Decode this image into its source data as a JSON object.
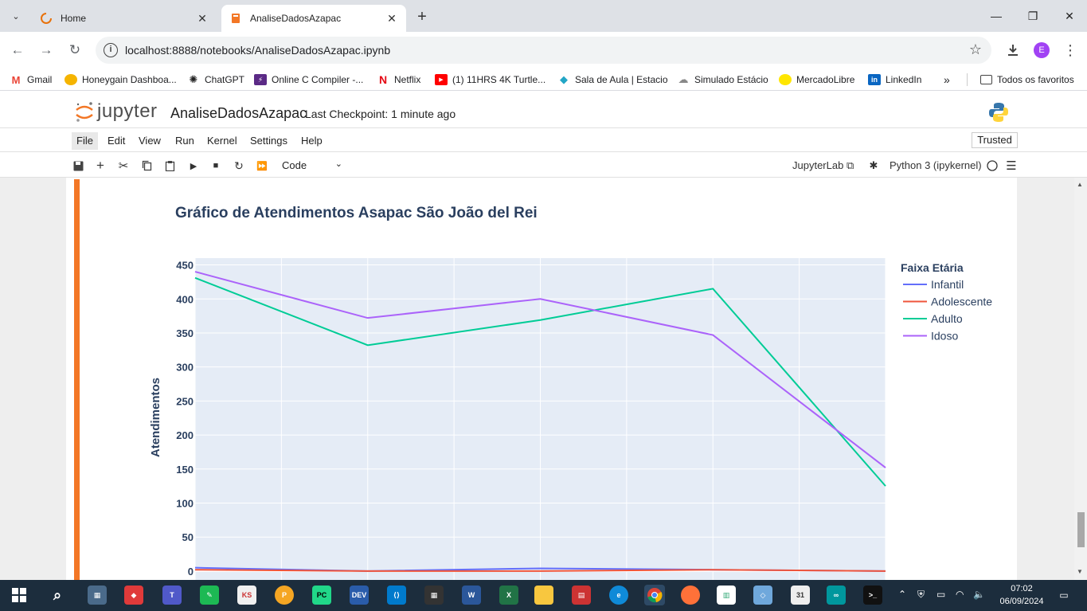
{
  "browser": {
    "tabs": [
      {
        "title": "Home",
        "active": false
      },
      {
        "title": "AnaliseDadosAzapac",
        "active": true
      }
    ],
    "url": "localhost:8888/notebooks/AnaliseDadosAzapac.ipynb",
    "profile_initial": "E",
    "bookmarks": [
      {
        "label": "Gmail"
      },
      {
        "label": "Honeygain Dashboa..."
      },
      {
        "label": "ChatGPT"
      },
      {
        "label": "Online C Compiler -..."
      },
      {
        "label": "Netflix"
      },
      {
        "label": "(1) 11HRS 4K Turtle..."
      },
      {
        "label": "Sala de Aula | Estacio"
      },
      {
        "label": "Simulado Estácio"
      },
      {
        "label": "MercadoLibre"
      },
      {
        "label": "LinkedIn"
      }
    ],
    "bookmarks_overflow": "»",
    "all_bookmarks": "Todos os favoritos"
  },
  "jupyter": {
    "logo_text": "jupyter",
    "notebook_name": "AnaliseDadosAzapac",
    "checkpoint": "Last Checkpoint: 1 minute ago",
    "menus": [
      "File",
      "Edit",
      "View",
      "Run",
      "Kernel",
      "Settings",
      "Help"
    ],
    "trusted": "Trusted",
    "cell_type": "Code",
    "jupyterlab": "JupyterLab",
    "kernel": "Python 3 (ipykernel)"
  },
  "chart_data": {
    "type": "line",
    "title": "Gráfico de Atendimentos Asapac São João del Rei",
    "ylabel": "Atendimentos",
    "xlabel": "",
    "ylim": [
      -20,
      460
    ],
    "yticks": [
      0,
      50,
      100,
      150,
      200,
      250,
      300,
      350,
      400,
      450
    ],
    "x": [
      0,
      1,
      2,
      3,
      4
    ],
    "legend_title": "Faixa Etária",
    "legend_position": "top-right",
    "series": [
      {
        "name": "Infantil",
        "color": "#636efa",
        "values": [
          5,
          0,
          4,
          2,
          0
        ]
      },
      {
        "name": "Adolescente",
        "color": "#ef553b",
        "values": [
          2,
          0,
          0,
          2,
          0
        ]
      },
      {
        "name": "Adulto",
        "color": "#00cc96",
        "values": [
          431,
          332,
          369,
          415,
          125
        ]
      },
      {
        "name": "Idoso",
        "color": "#ab63fa",
        "values": [
          440,
          372,
          400,
          347,
          152
        ]
      }
    ],
    "plot_background": "#e5ecf6"
  },
  "taskbar": {
    "time": "07:02",
    "date": "06/09/2024"
  }
}
